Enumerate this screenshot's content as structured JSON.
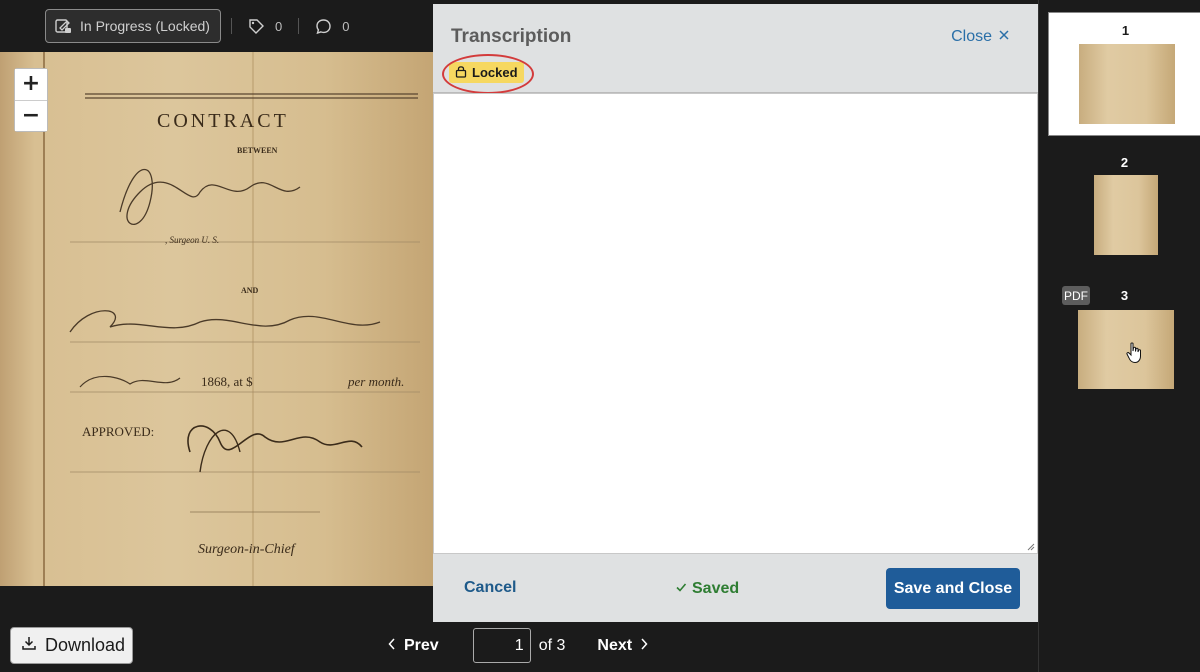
{
  "toolbar": {
    "status_label": "In Progress (Locked)",
    "tags_count": "0",
    "comments_count": "0"
  },
  "viewer": {
    "zoom_in": "+",
    "zoom_out": "−",
    "document_text": {
      "heading": "CONTRACT",
      "between": "BETWEEN",
      "surgeon_line": ", Surgeon U. S.",
      "and": "AND",
      "month_line": "1868, at $",
      "per_month": "per month.",
      "approved": "APPROVED:",
      "surgeon_in_chief": "Surgeon-in-Chief"
    }
  },
  "panel": {
    "title": "Transcription",
    "close_label": "Close",
    "locked_label": "Locked",
    "textarea_value": "",
    "cancel_label": "Cancel",
    "saved_label": "Saved",
    "save_close_label": "Save and Close"
  },
  "bottom": {
    "download_label": "Download",
    "prev_label": "Prev",
    "next_label": "Next",
    "page_value": "1",
    "of_total": "of 3"
  },
  "thumbnails": [
    {
      "number": "1",
      "active": true
    },
    {
      "number": "2",
      "active": false
    },
    {
      "number": "3",
      "active": false,
      "badge": "PDF"
    }
  ],
  "colors": {
    "accent": "#1f5c99",
    "link": "#2a6fa8",
    "locked_badge": "#f6d860",
    "highlight_ring": "#d33b3b",
    "saved_green": "#2e7d32",
    "background_dark": "#1b1b1b"
  }
}
